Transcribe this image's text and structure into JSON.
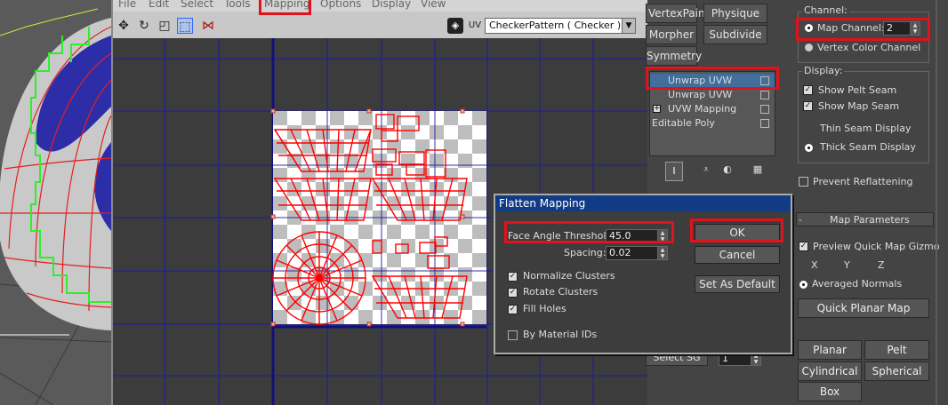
{
  "menu": {
    "file": "File",
    "edit": "Edit",
    "select": "Select",
    "tools": "Tools",
    "mapping": "Mapping",
    "options": "Options",
    "display": "Display",
    "view": "View"
  },
  "toolbar": {
    "uv_label": "UV",
    "texture_combo": "CheckerPattern  ( Checker )"
  },
  "modifier_buttons": {
    "vertexpaint": "VertexPaint",
    "physique": "Physique",
    "morpher": "Morpher",
    "subdivide": "Subdivide",
    "symmetry": "Symmetry"
  },
  "stack": {
    "items": [
      {
        "label": "Unwrap UVW",
        "selected": true
      },
      {
        "label": "Unwrap UVW",
        "selected": false
      },
      {
        "label": "UVW Mapping",
        "selected": false,
        "expander": "+"
      },
      {
        "label": "Editable Poly",
        "selected": false
      }
    ]
  },
  "channel": {
    "title": "Channel:",
    "map_channel_label": "Map Channel:",
    "map_channel_value": "2",
    "vertex_color_label": "Vertex Color Channel"
  },
  "display": {
    "title": "Display:",
    "show_pelt_seam": "Show Pelt Seam",
    "show_map_seam": "Show Map Seam",
    "thin_seam": "Thin Seam Display",
    "thick_seam": "Thick Seam Display"
  },
  "prevent_reflattening": "Prevent Reflattening",
  "map_params": {
    "title": "Map Parameters",
    "collapse": "-",
    "preview_gizmo": "Preview Quick Map Gizmo",
    "x": "X",
    "y": "Y",
    "z": "Z",
    "averaged_normals": "Averaged Normals",
    "quick_planar": "Quick Planar Map",
    "planar": "Planar",
    "pelt": "Pelt",
    "cylindrical": "Cylindrical",
    "spherical": "Spherical",
    "box": "Box"
  },
  "select_sg": {
    "label": "Select SG",
    "value": "1"
  },
  "dialog": {
    "title": "Flatten Mapping",
    "face_angle_label": "Face Angle Threshold:",
    "face_angle_value": "45.0",
    "spacing_label": "Spacing:",
    "spacing_value": "0.02",
    "normalize": "Normalize Clusters",
    "rotate": "Rotate Clusters",
    "fill_holes": "Fill Holes",
    "by_material": "By Material IDs",
    "ok": "OK",
    "cancel": "Cancel",
    "set_default": "Set As Default"
  },
  "colors": {
    "highlight": "#e0121b",
    "grid": "#1a1aa6",
    "uv_edges": "#ff0000",
    "title_bar": "#123b86"
  }
}
